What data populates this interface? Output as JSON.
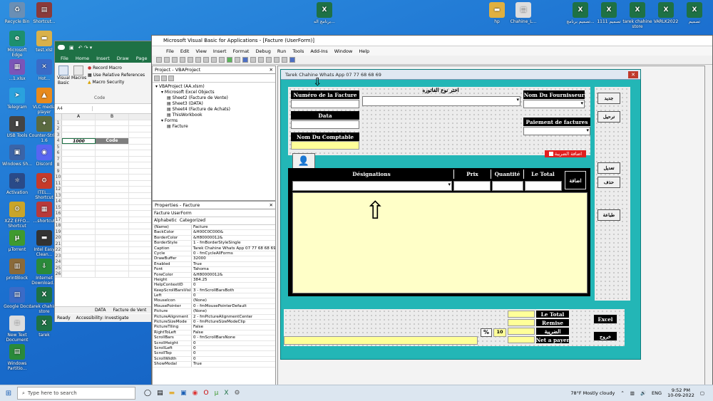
{
  "desktop": {
    "left_icons": [
      {
        "label": "Recycle Bin",
        "color": "#6a8fb5",
        "glyph": "♻"
      },
      {
        "label": "Shortcut...",
        "color": "#8a3a3a",
        "glyph": "▤"
      },
      {
        "label": "Microsoft Edge",
        "color": "#1d8f6e",
        "glyph": "e"
      },
      {
        "label": "test.xlsl",
        "color": "#d9b14a",
        "glyph": "▬"
      },
      {
        "label": "...1.xlsx",
        "color": "#7a55b8",
        "glyph": "▦"
      },
      {
        "label": "Hot...",
        "color": "#3a6bc7",
        "glyph": "✕"
      },
      {
        "label": "Telegram",
        "color": "#2aa2de",
        "glyph": "➤"
      },
      {
        "label": "VLC media player",
        "color": "#e88a1c",
        "glyph": "▲"
      },
      {
        "label": "USB Tools",
        "color": "#444",
        "glyph": "▮"
      },
      {
        "label": "Counter-Strike 1.6",
        "color": "#5a6a40",
        "glyph": "✦"
      },
      {
        "label": "Windows Sh...",
        "color": "#3a64a8",
        "glyph": "▣"
      },
      {
        "label": "Discord",
        "color": "#5865f2",
        "glyph": "◉"
      },
      {
        "label": "Activation",
        "color": "#2a4a88",
        "glyph": "☼"
      },
      {
        "label": "ITEL... Shortcut",
        "color": "#c63a2a",
        "glyph": "⚙"
      },
      {
        "label": "XZZ EFFO... Shortcut",
        "color": "#c9a52a",
        "glyph": "⚙"
      },
      {
        "label": "...shortcut",
        "color": "#b83a3a",
        "glyph": "▦"
      },
      {
        "label": "µTorrent",
        "color": "#3f9a2f",
        "glyph": "µ"
      },
      {
        "label": "Intel Easy Clean...",
        "color": "#333",
        "glyph": "▬"
      },
      {
        "label": "printBlock",
        "color": "#8a6a3a",
        "glyph": "▥"
      },
      {
        "label": "Internet Download...",
        "color": "#2a8a3a",
        "glyph": "⇩"
      },
      {
        "label": "Google Docs",
        "color": "#3a6bc7",
        "glyph": "▤"
      },
      {
        "label": "tarek chahine store",
        "color": "#1e7145",
        "glyph": "X"
      },
      {
        "label": "New Text Document",
        "color": "#ddd",
        "glyph": "≡"
      },
      {
        "label": "tarek",
        "color": "#1e7145",
        "glyph": "X"
      },
      {
        "label": "Windows Partitio...",
        "color": "#2a8a3a",
        "glyph": "▤"
      }
    ],
    "top_icons": [
      {
        "label": "برنامج اله...",
        "color": "#1e7145",
        "glyph": "X"
      },
      {
        "label": "hp",
        "color": "#e0b040",
        "glyph": "▬"
      },
      {
        "label": "Chahine_L...",
        "color": "#ddd",
        "glyph": "▤"
      },
      {
        "label": "تصميم برنامج...",
        "color": "#1e7145",
        "glyph": "X"
      },
      {
        "label": "تصميم 1111",
        "color": "#1e7145",
        "glyph": "X"
      },
      {
        "label": "tarek chahine store",
        "color": "#1e7145",
        "glyph": "X"
      },
      {
        "label": "VARLK2022",
        "color": "#1e7145",
        "glyph": "X"
      },
      {
        "label": "تصميم",
        "color": "#1e7145",
        "glyph": "X"
      }
    ]
  },
  "excel": {
    "qat": "↶ ↷ ▾",
    "tabs": [
      "File",
      "Home",
      "Insert",
      "Draw",
      "Page"
    ],
    "ribbon_items": [
      "Visual Basic",
      "Macros",
      "Record Macro",
      "Use Relative References",
      "Macro Security"
    ],
    "ribbon_group": "Code",
    "name_box": "A4",
    "col_a": "A",
    "col_b": "B",
    "rows": [
      {
        "n": "1",
        "a": "",
        "b": ""
      },
      {
        "n": "2",
        "a": "",
        "b": ""
      },
      {
        "n": "3",
        "a": "",
        "b": ""
      },
      {
        "n": "4",
        "a": "1000",
        "b": "Code"
      },
      {
        "n": "5",
        "a": "",
        "b": ""
      },
      {
        "n": "6",
        "a": "",
        "b": ""
      },
      {
        "n": "7",
        "a": "",
        "b": ""
      },
      {
        "n": "8",
        "a": "",
        "b": ""
      },
      {
        "n": "9",
        "a": "",
        "b": ""
      },
      {
        "n": "10",
        "a": "",
        "b": ""
      },
      {
        "n": "11",
        "a": "",
        "b": ""
      },
      {
        "n": "12",
        "a": "",
        "b": ""
      },
      {
        "n": "13",
        "a": "",
        "b": ""
      },
      {
        "n": "14",
        "a": "",
        "b": ""
      },
      {
        "n": "15",
        "a": "",
        "b": ""
      },
      {
        "n": "16",
        "a": "",
        "b": ""
      },
      {
        "n": "17",
        "a": "",
        "b": ""
      },
      {
        "n": "18",
        "a": "",
        "b": ""
      },
      {
        "n": "19",
        "a": "",
        "b": ""
      },
      {
        "n": "20",
        "a": "",
        "b": ""
      },
      {
        "n": "21",
        "a": "",
        "b": ""
      },
      {
        "n": "22",
        "a": "",
        "b": ""
      },
      {
        "n": "23",
        "a": "",
        "b": ""
      },
      {
        "n": "24",
        "a": "",
        "b": ""
      },
      {
        "n": "25",
        "a": "",
        "b": ""
      },
      {
        "n": "26",
        "a": "",
        "b": ""
      }
    ],
    "sheet_tabs": [
      "DATA",
      "Facture de Vent"
    ],
    "status_ready": "Ready",
    "status_access": "Accessibility: Investigate"
  },
  "vba": {
    "title": "Microsoft Visual Basic for Applications - [Facture (UserForm)]",
    "menu": [
      "File",
      "Edit",
      "View",
      "Insert",
      "Format",
      "Debug",
      "Run",
      "Tools",
      "Add-Ins",
      "Window",
      "Help"
    ],
    "project_title": "Project - VBAProject",
    "tree": [
      {
        "label": "VBAProject (AA.xlsm)",
        "indent": 0
      },
      {
        "label": "Microsoft Excel Objects",
        "indent": 1
      },
      {
        "label": "Sheet2 (Facture de Vente)",
        "indent": 2
      },
      {
        "label": "Sheet3 (DATA)",
        "indent": 2
      },
      {
        "label": "Sheet4 (Facture de Achats)",
        "indent": 2
      },
      {
        "label": "ThisWorkbook",
        "indent": 2
      },
      {
        "label": "Forms",
        "indent": 1
      },
      {
        "label": "Facture",
        "indent": 2
      }
    ],
    "props_title": "Properties - Facture",
    "props_object": "Facture  UserForm",
    "props_tabs": [
      "Alphabetic",
      "Categorized"
    ],
    "props": [
      {
        "k": "(Name)",
        "v": "Facture"
      },
      {
        "k": "BackColor",
        "v": "&H00C0C000&"
      },
      {
        "k": "BorderColor",
        "v": "&H80000012&"
      },
      {
        "k": "BorderStyle",
        "v": "1 - fmBorderStyleSingle"
      },
      {
        "k": "Caption",
        "v": "Tarek Chahine Whats App 07 77 68 68 69"
      },
      {
        "k": "Cycle",
        "v": "0 - fmCycleAllForms"
      },
      {
        "k": "DrawBuffer",
        "v": "32000"
      },
      {
        "k": "Enabled",
        "v": "True"
      },
      {
        "k": "Font",
        "v": "Tahoma"
      },
      {
        "k": "ForeColor",
        "v": "&H80000012&"
      },
      {
        "k": "Height",
        "v": "384.25"
      },
      {
        "k": "HelpContextID",
        "v": "0"
      },
      {
        "k": "KeepScrollBarsVisible",
        "v": "3 - fmScrollBarsBoth"
      },
      {
        "k": "Left",
        "v": "0"
      },
      {
        "k": "MouseIcon",
        "v": "(None)"
      },
      {
        "k": "MousePointer",
        "v": "0 - fmMousePointerDefault"
      },
      {
        "k": "Picture",
        "v": "(None)"
      },
      {
        "k": "PictureAlignment",
        "v": "2 - fmPictureAlignmentCenter"
      },
      {
        "k": "PictureSizeMode",
        "v": "0 - fmPictureSizeModeClip"
      },
      {
        "k": "PictureTiling",
        "v": "False"
      },
      {
        "k": "RightToLeft",
        "v": "False"
      },
      {
        "k": "ScrollBars",
        "v": "0 - fmScrollBarsNone"
      },
      {
        "k": "ScrollHeight",
        "v": "0"
      },
      {
        "k": "ScrollLeft",
        "v": "0"
      },
      {
        "k": "ScrollTop",
        "v": "0"
      },
      {
        "k": "ScrollWidth",
        "v": "0"
      },
      {
        "k": "ShowModal",
        "v": "True"
      }
    ]
  },
  "form": {
    "caption": "Tarek Chahine Whats App 07 77 68 68 69",
    "numero_facture": "Numéro de la Facture",
    "type_facture": "اختر نوع الفاتوره",
    "fournisseur": "Nom Du Fournisseur",
    "data_label": "Data",
    "paiement": "Paiement de factures",
    "comptable": "Nom Du Comptable",
    "tax_check": "اضافة الضريبة",
    "designations": "Désignations",
    "prix": "Prix",
    "quantite": "Quantité",
    "le_total": "Le Total",
    "btn_add": "اضافة",
    "btn_new": "جديد",
    "btn_transfer": "ترحيل",
    "btn_edit": "تعديل",
    "btn_delete": "حذف",
    "btn_print": "طباعة",
    "sum_total": "Le Total",
    "sum_remise": "Remise",
    "sum_tax": "الضريبة",
    "sum_net": "Net a payer",
    "pct": "%",
    "tax_rate": "10",
    "btn_excel": "Excel",
    "btn_exit": "خروج"
  },
  "taskbar": {
    "search": "Type here to search",
    "weather": "78°F  Mostly cloudy",
    "lang": "ENG",
    "time": "9:52 PM",
    "date": "10-09-2022"
  }
}
